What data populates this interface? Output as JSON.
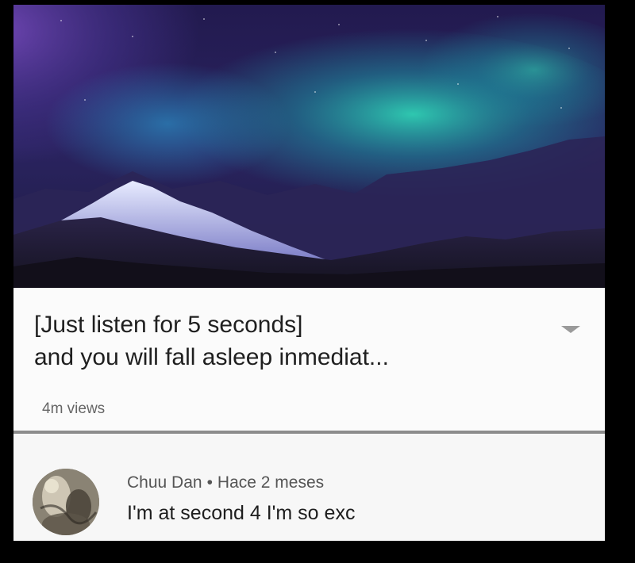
{
  "video": {
    "title_line1": "[Just listen for 5 seconds]",
    "title_line2": "and you will fall asleep inmediat...",
    "views": "4m views"
  },
  "comment": {
    "author": "Chuu Dan",
    "separator": "•",
    "time": "Hace 2 meses",
    "text": "I'm at second 4 I'm so exc"
  },
  "icons": {
    "expand": "chevron-down-icon"
  },
  "colors": {
    "background": "#000000",
    "card": "#f9f9f9",
    "title_text": "#1f1f1f",
    "secondary_text": "#666666",
    "aurora_teal": "#1fb5a4",
    "aurora_purple": "#5b3b9a"
  }
}
